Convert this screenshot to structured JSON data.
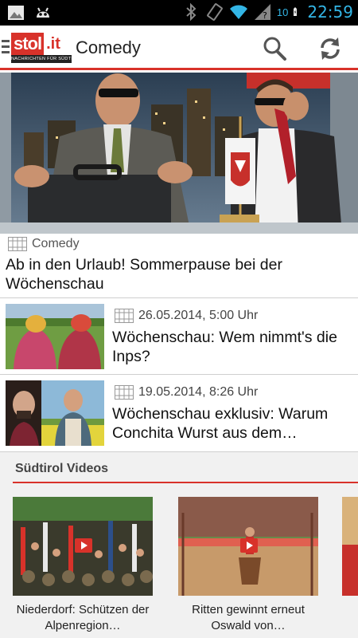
{
  "status_bar": {
    "time": "22:59",
    "signal_label": "10",
    "icons": [
      "gallery-icon",
      "android-icon",
      "bluetooth-icon",
      "rotation-icon",
      "wifi-icon",
      "cellular-icon",
      "battery-icon"
    ],
    "accent_color": "#33b5e5"
  },
  "action_bar": {
    "logo_main": "stol",
    "logo_suffix": ".it",
    "logo_tagline": "NACHRICHTEN FÜR SÜDTIROL",
    "title": "Comedy",
    "icons": [
      "drawer-icon",
      "search-icon",
      "refresh-icon"
    ],
    "accent_color": "#d8322a"
  },
  "hero": {
    "category": "Comedy",
    "title": "Ab in den Urlaub! Sommerpause bei der Wöchenschau"
  },
  "articles": [
    {
      "date": "26.05.2014, 5:00 Uhr",
      "title": "Wöchenschau: Wem nimmt's die Inps?"
    },
    {
      "date": "19.05.2014, 8:26 Uhr",
      "title": "Wöchenschau exklusiv: Warum Conchita Wurst aus dem…"
    }
  ],
  "section": {
    "title": "Südtirol Videos",
    "videos": [
      {
        "title": "Niederdorf: Schützen der Alpenregion…"
      },
      {
        "title": "Ritten gewinnt erneut Oswald von…"
      }
    ]
  }
}
